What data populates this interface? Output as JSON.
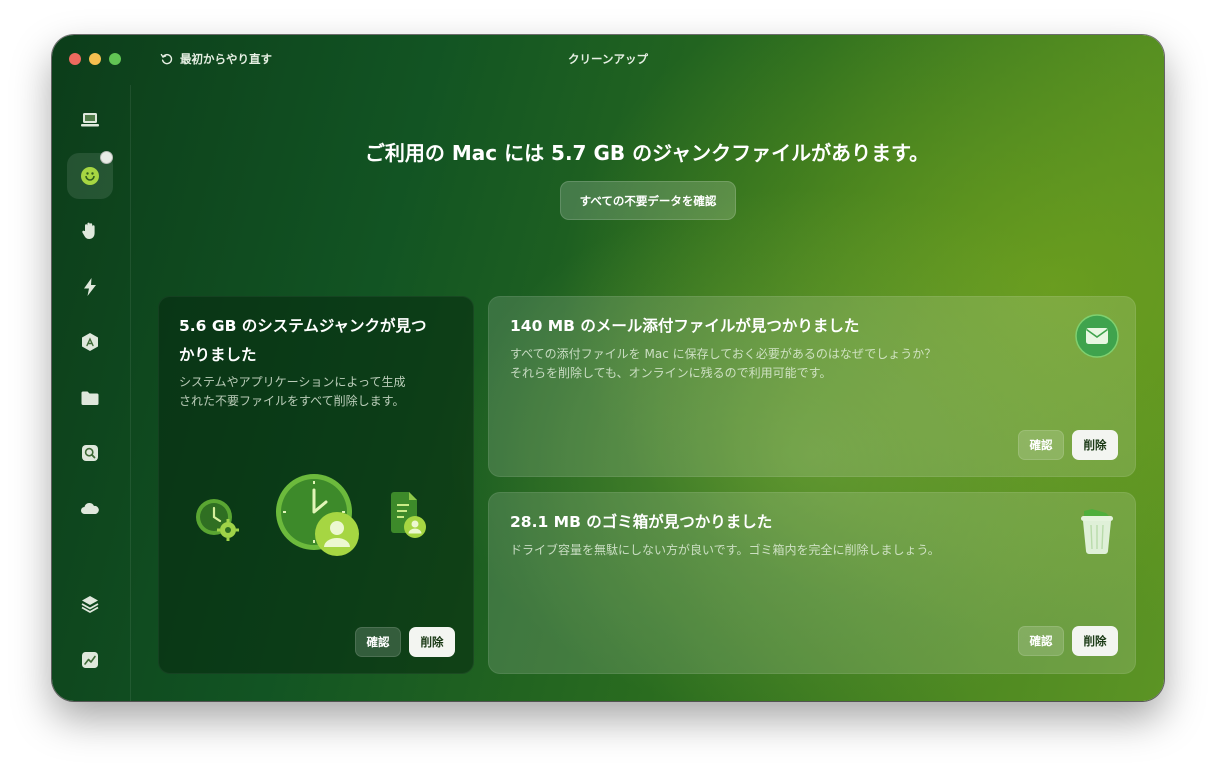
{
  "window": {
    "title": "クリーンアップ",
    "restart_label": "最初からやり直す"
  },
  "sidebar": {
    "items": [
      {
        "name": "system-overview",
        "icon": "laptop-icon"
      },
      {
        "name": "cleanup",
        "icon": "cleanup-icon",
        "active": true
      },
      {
        "name": "protection",
        "icon": "hand-icon"
      },
      {
        "name": "performance",
        "icon": "lightning-icon"
      },
      {
        "name": "applications",
        "icon": "app-store-icon"
      },
      {
        "name": "files",
        "icon": "folder-icon"
      },
      {
        "name": "space-lens",
        "icon": "magnifier-icon"
      },
      {
        "name": "cloud",
        "icon": "cloud-icon"
      },
      {
        "name": "my-clutter",
        "icon": "layers-icon"
      },
      {
        "name": "assistant",
        "icon": "chart-icon"
      }
    ]
  },
  "main": {
    "headline": "ご利用の Mac には 5.7 GB のジャンクファイルがあります。",
    "review_all_label": "すべての不要データを確認"
  },
  "cards": {
    "system_junk": {
      "title": "5.6 GB のシステムジャンクが見つかりました",
      "title_line1": "5.6 GB のシステムジャンクが見つ",
      "title_line2": "かりました",
      "desc_line1": "システムやアプリケーションによって生成",
      "desc_line2": "された不要ファイルをすべて削除します。",
      "review_label": "確認",
      "delete_label": "削除"
    },
    "mail": {
      "title": "140 MB のメール添付ファイルが見つかりました",
      "desc_line1": "すべての添付ファイルを Mac に保存しておく必要があるのはなぜでしょうか？",
      "desc_line2": "それらを削除しても、オンラインに残るので利用可能です。",
      "review_label": "確認",
      "delete_label": "削除"
    },
    "trash": {
      "title": "28.1 MB のゴミ箱が見つかりました",
      "desc": "ドライブ容量を無駄にしない方が良いです。ゴミ箱内を完全に削除しましょう。",
      "review_label": "確認",
      "delete_label": "削除"
    }
  },
  "colors": {
    "accent_green": "#4caf50",
    "delete_button_bg": "#f3f5f1",
    "traffic_red": "#ed6a5e",
    "traffic_yellow": "#f5bf4f",
    "traffic_green": "#61c554"
  }
}
